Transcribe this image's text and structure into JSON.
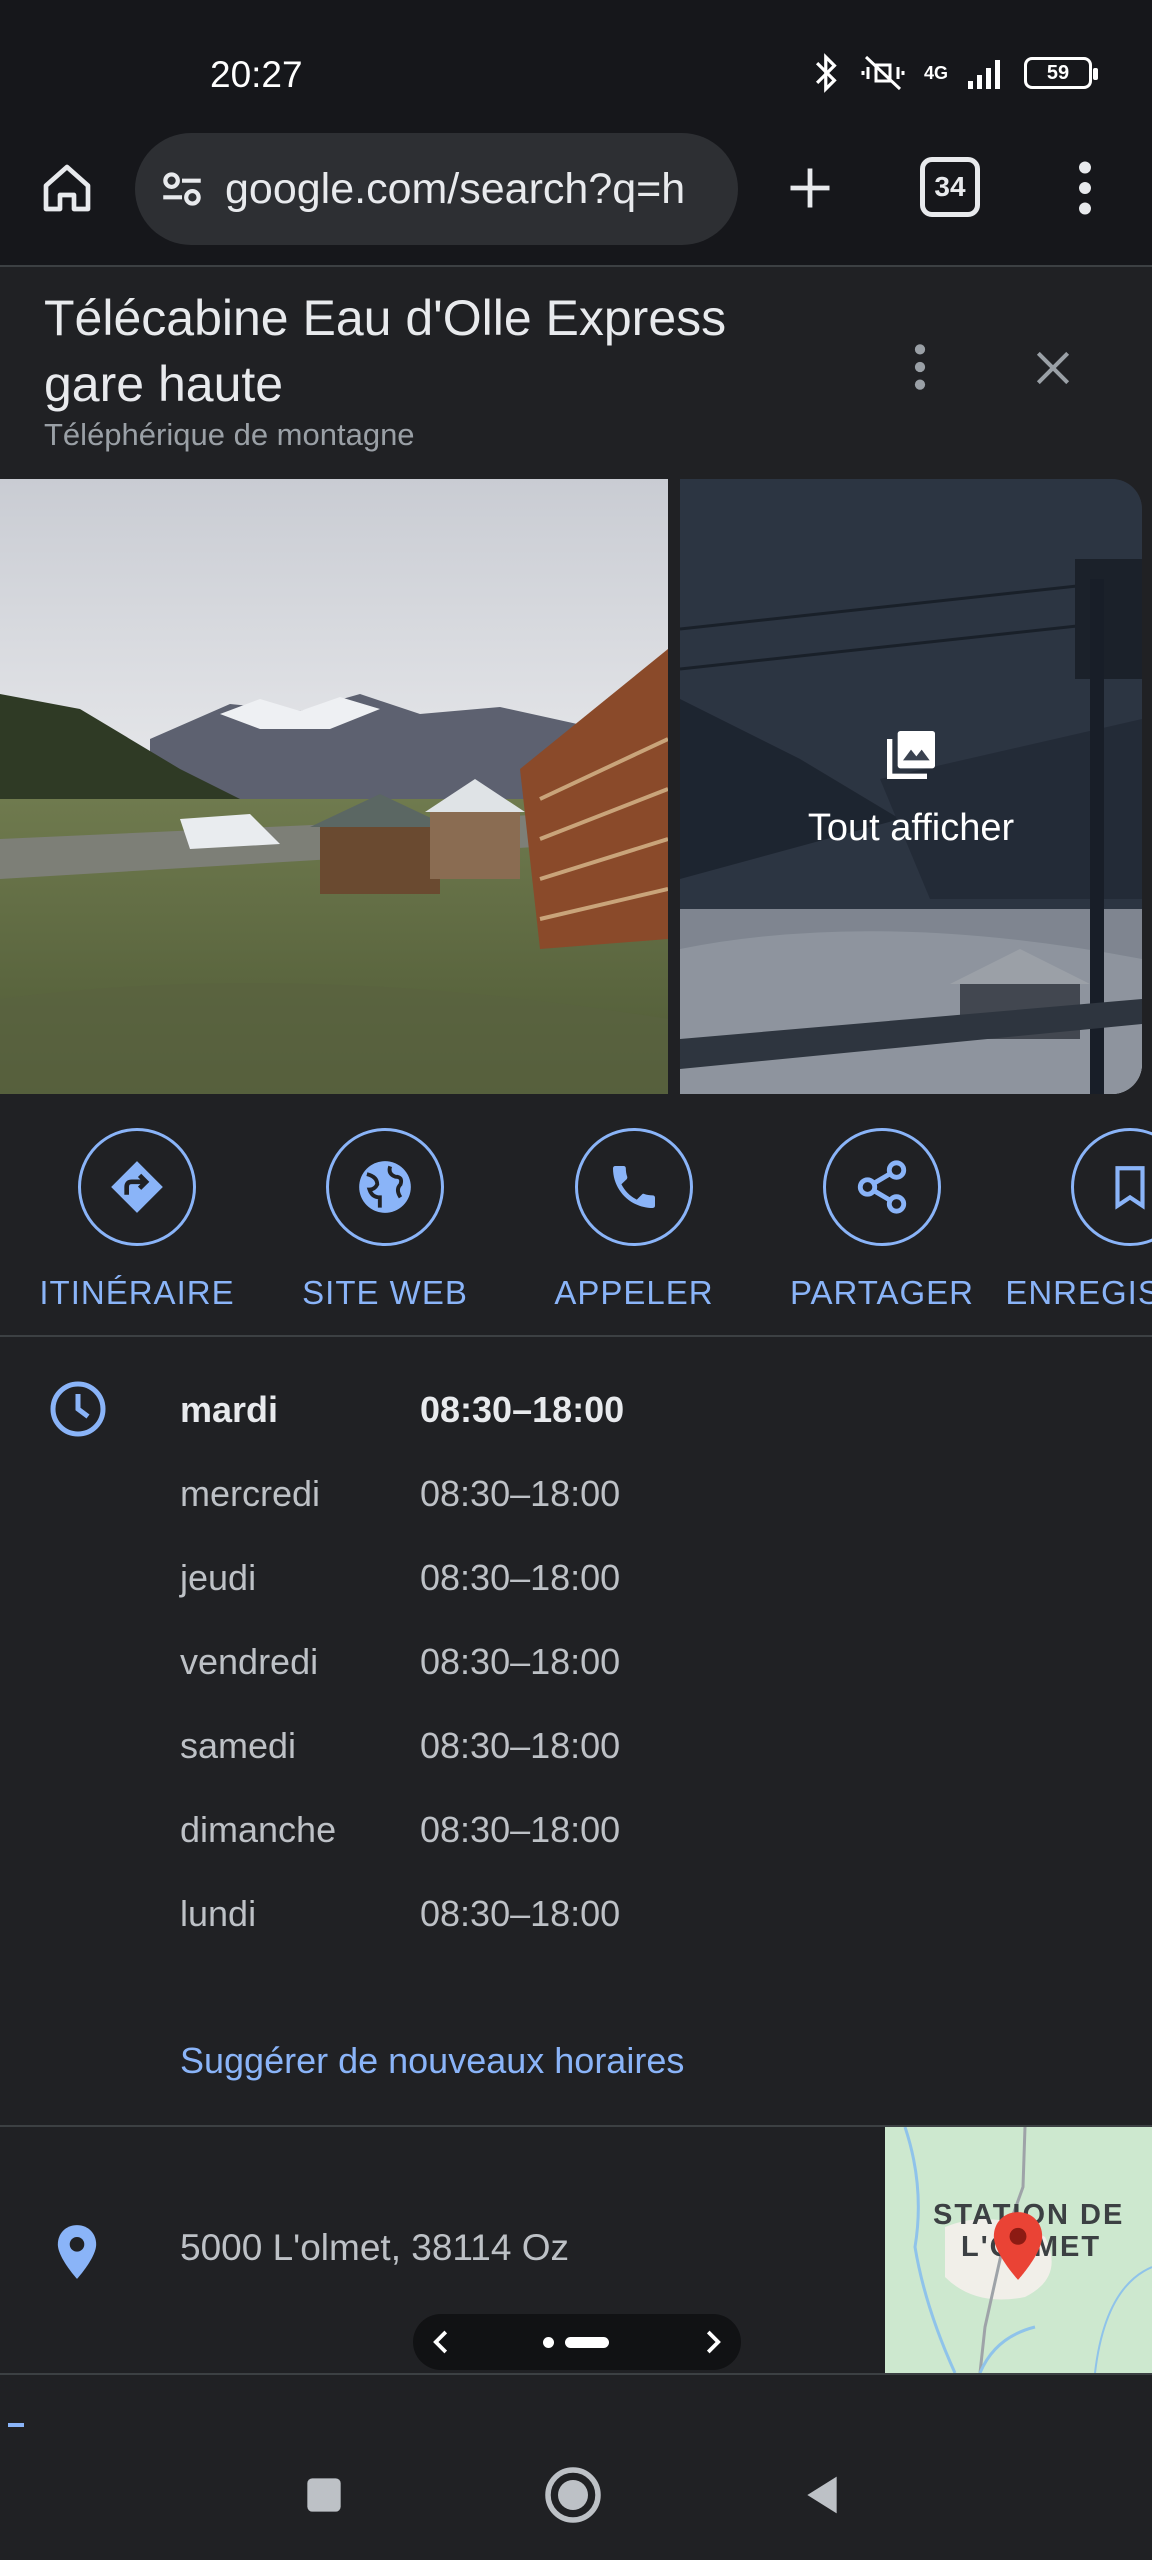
{
  "status_bar": {
    "time": "20:27",
    "network": "4G",
    "battery": "59"
  },
  "browser": {
    "url": "google.com/search?q=h",
    "tab_count": "34"
  },
  "place": {
    "title": "Télécabine Eau d'Olle Express gare haute",
    "subtitle": "Téléphérique de montagne",
    "see_all_label": "Tout afficher"
  },
  "actions": [
    {
      "label": "ITINÉRAIRE",
      "icon": "directions-icon"
    },
    {
      "label": "SITE WEB",
      "icon": "globe-icon"
    },
    {
      "label": "APPELER",
      "icon": "phone-icon"
    },
    {
      "label": "PARTAGER",
      "icon": "share-icon"
    },
    {
      "label": "ENREGISTRER",
      "icon": "bookmark-icon"
    }
  ],
  "hours": {
    "rows": [
      {
        "day": "mardi",
        "time": "08:30–18:00",
        "today": true
      },
      {
        "day": "mercredi",
        "time": "08:30–18:00"
      },
      {
        "day": "jeudi",
        "time": "08:30–18:00"
      },
      {
        "day": "vendredi",
        "time": "08:30–18:00"
      },
      {
        "day": "samedi",
        "time": "08:30–18:00"
      },
      {
        "day": "dimanche",
        "time": "08:30–18:00"
      },
      {
        "day": "lundi",
        "time": "08:30–18:00"
      }
    ],
    "suggest_link": "Suggérer de nouveaux horaires"
  },
  "address": {
    "text": "5000 L'olmet, 38114 Oz",
    "map_label_line1": "STATION DE",
    "map_label_line2": "L'OLMET"
  },
  "colors": {
    "accent": "#8ab4f8",
    "background": "#202124",
    "pin": "#ea4335"
  }
}
